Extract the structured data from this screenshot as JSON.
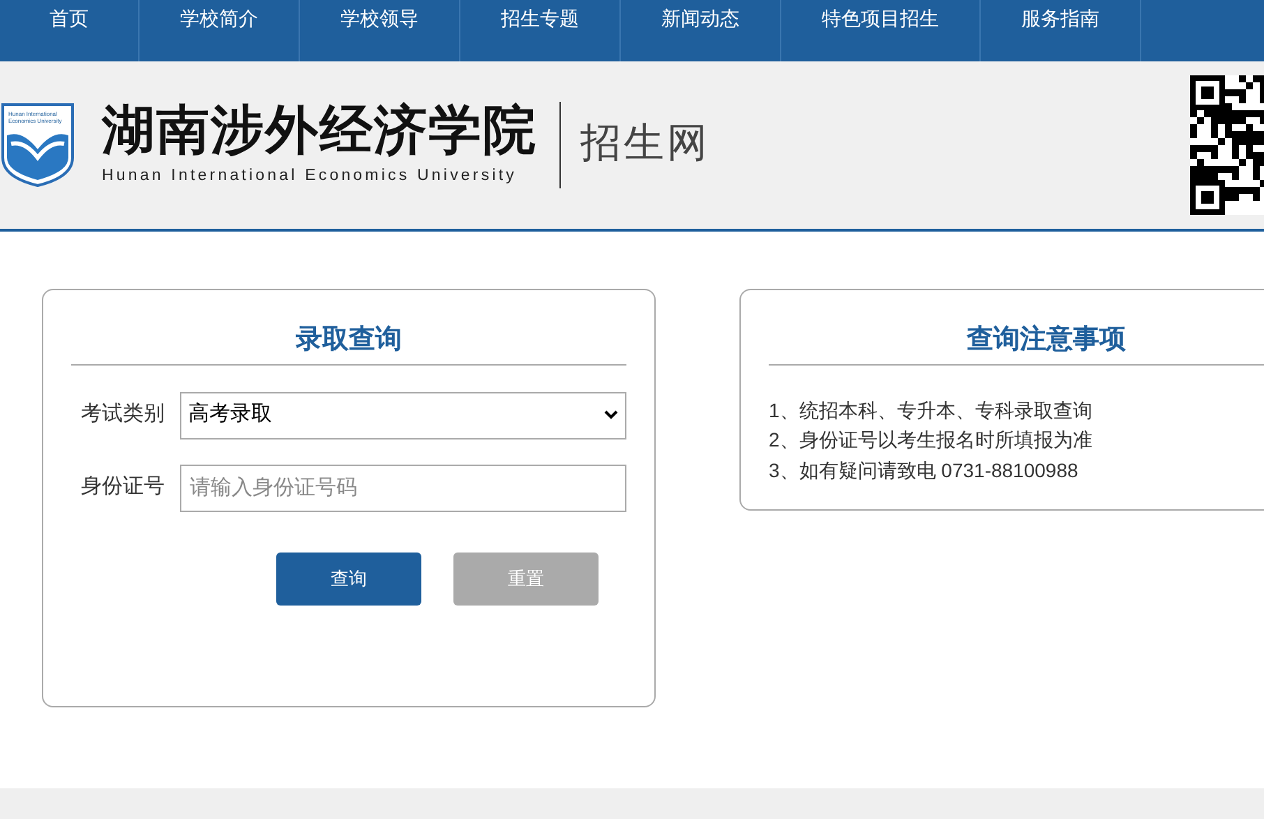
{
  "nav": [
    {
      "label": "首页",
      "selected": false
    },
    {
      "label": "学校简介",
      "selected": false
    },
    {
      "label": "学校领导",
      "selected": false
    },
    {
      "label": "招生专题",
      "selected": false
    },
    {
      "label": "新闻动态",
      "selected": false
    },
    {
      "label": "特色项目招生",
      "selected": false
    },
    {
      "label": "服务指南",
      "selected": false
    }
  ],
  "header": {
    "logo_text": "Hunan International Economics University",
    "title": "湖南涉外经济学院",
    "subtitle": "Hunan International Economics University",
    "site_name": "招生网"
  },
  "query_form": {
    "title": "录取查询",
    "exam_type_label": "考试类别",
    "exam_type_value": "高考录取",
    "id_label": "身份证号",
    "id_placeholder": "请输入身份证号码",
    "buttons": [
      {
        "label": "查询",
        "kind": "primary"
      },
      {
        "label": "重置",
        "kind": "secondary"
      }
    ]
  },
  "notes": {
    "title": "查询注意事项",
    "items": [
      "1、统招本科、专升本、专科录取查询",
      "2、身份证号以考生报名时所填报为准",
      "3、如有疑问请致电 0731-88100988"
    ]
  }
}
